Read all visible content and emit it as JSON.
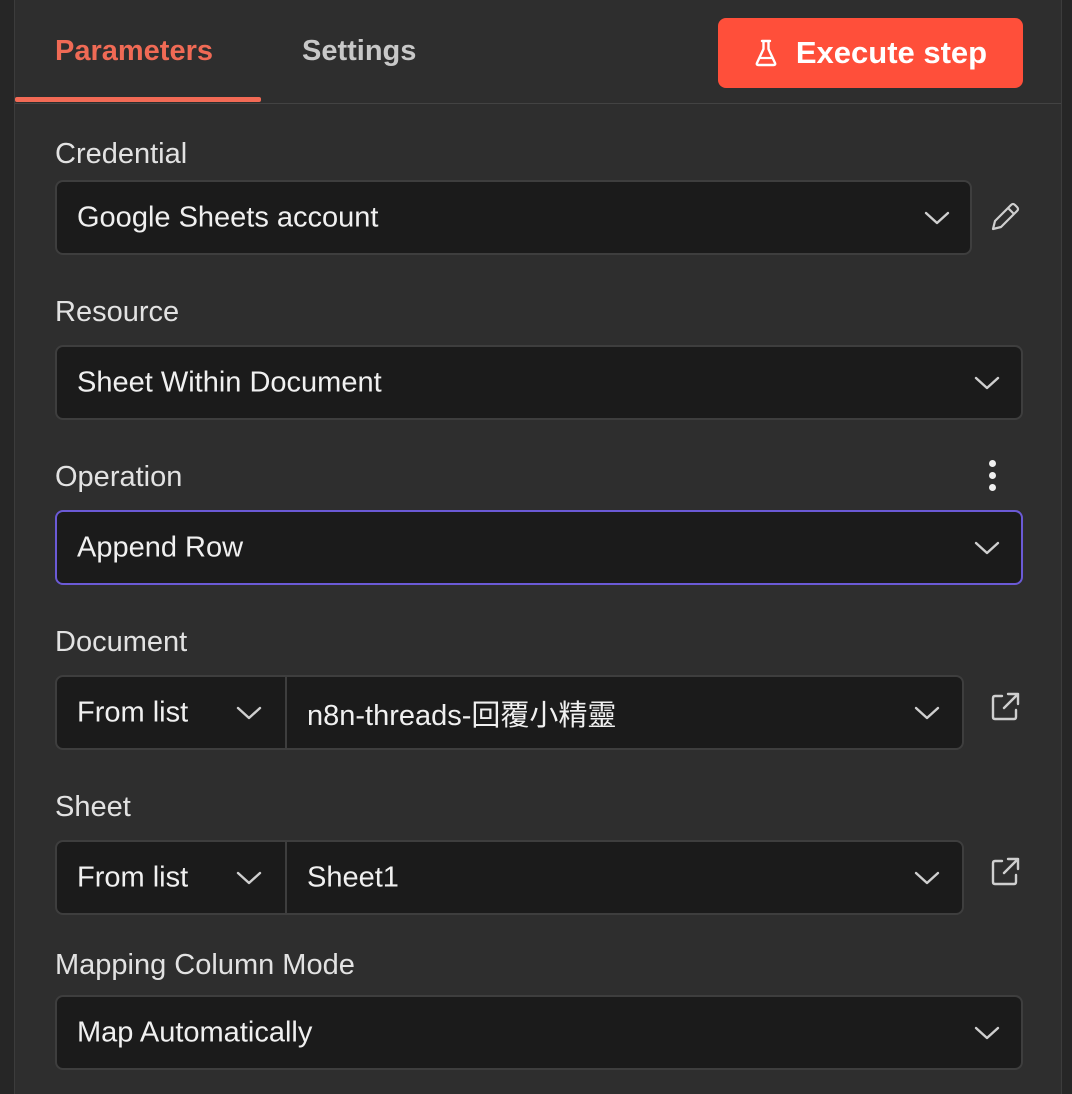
{
  "tabs": [
    {
      "label": "Parameters",
      "active": true
    },
    {
      "label": "Settings",
      "active": false
    }
  ],
  "execute_button": {
    "label": "Execute step",
    "icon": "flask-icon"
  },
  "fields": {
    "credential": {
      "label": "Credential",
      "value": "Google Sheets account",
      "side_icon": "pencil-icon"
    },
    "resource": {
      "label": "Resource",
      "value": "Sheet Within Document"
    },
    "operation": {
      "label": "Operation",
      "value": "Append Row",
      "menu_icon": "more-vertical-icon"
    },
    "document": {
      "label": "Document",
      "mode": "From list",
      "value": "n8n-threads-回覆小精靈",
      "side_icon": "external-link-icon"
    },
    "sheet": {
      "label": "Sheet",
      "mode": "From list",
      "value": "Sheet1",
      "side_icon": "external-link-icon"
    },
    "mapping_mode": {
      "label": "Mapping Column Mode",
      "value": "Map Automatically"
    }
  },
  "colors": {
    "accent": "#ff4f3a",
    "active_tab": "#f06a55",
    "focus_border": "#6b5ad6",
    "background": "#2e2e2e",
    "field_bg": "#1b1b1b"
  }
}
